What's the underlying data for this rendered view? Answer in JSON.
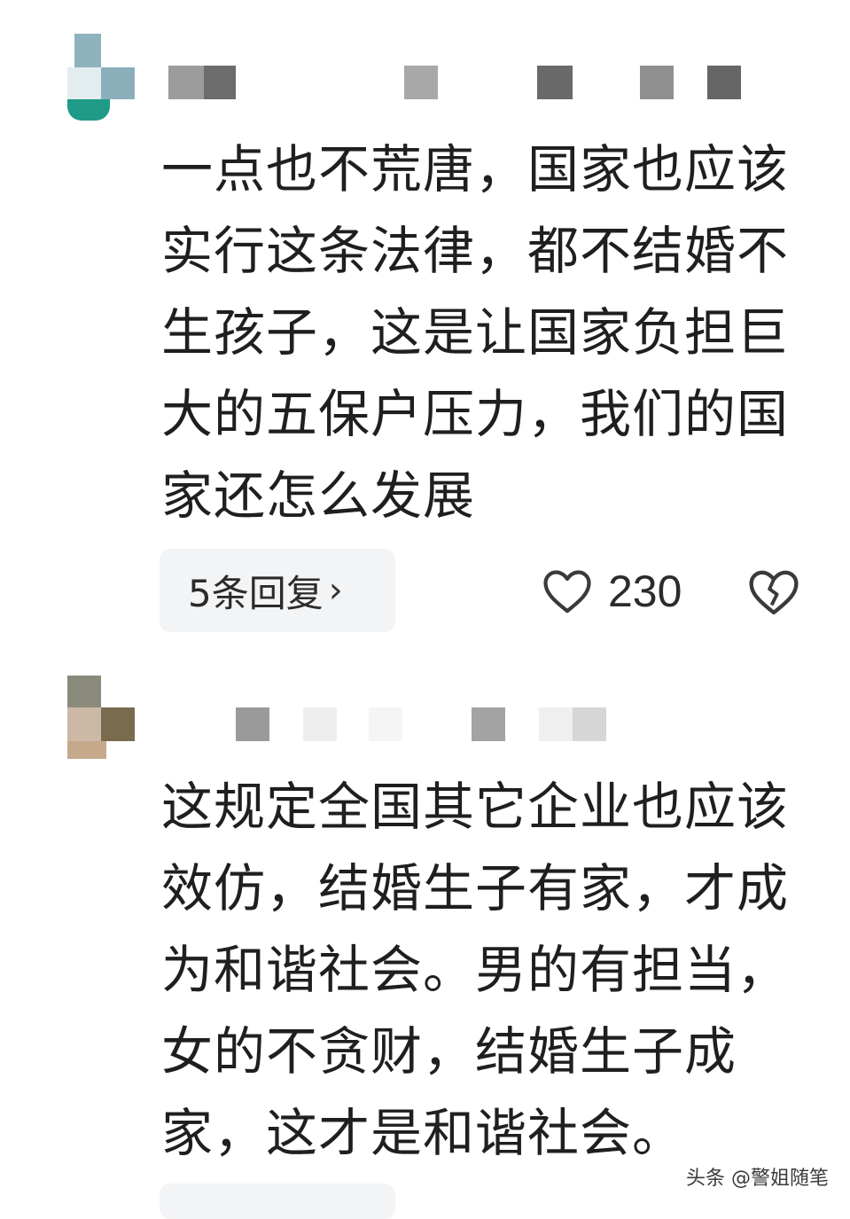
{
  "comments": [
    {
      "text": "一点也不荒唐，国家也应该实行这条法律，都不结婚不生孩子，这是让国家负担巨大的五保户压力，我们的国家还怎么发展",
      "reply_label": "5条回复",
      "reply_chevron": "›",
      "likes": "230",
      "like_icon": "heart-outline-icon",
      "dislike_icon": "broken-heart-icon"
    },
    {
      "text": "这规定全国其它企业也应该效仿，结婚生子有家，才成为和谐社会。男的有担当，女的不贪财，结婚生子成家，这才是和谐社会。"
    }
  ],
  "watermark": "头条 @警姐随笔",
  "colors": {
    "text": "#1f1f1f",
    "reply_bg": "#f3f4f6",
    "icon": "#3a3a3a"
  }
}
